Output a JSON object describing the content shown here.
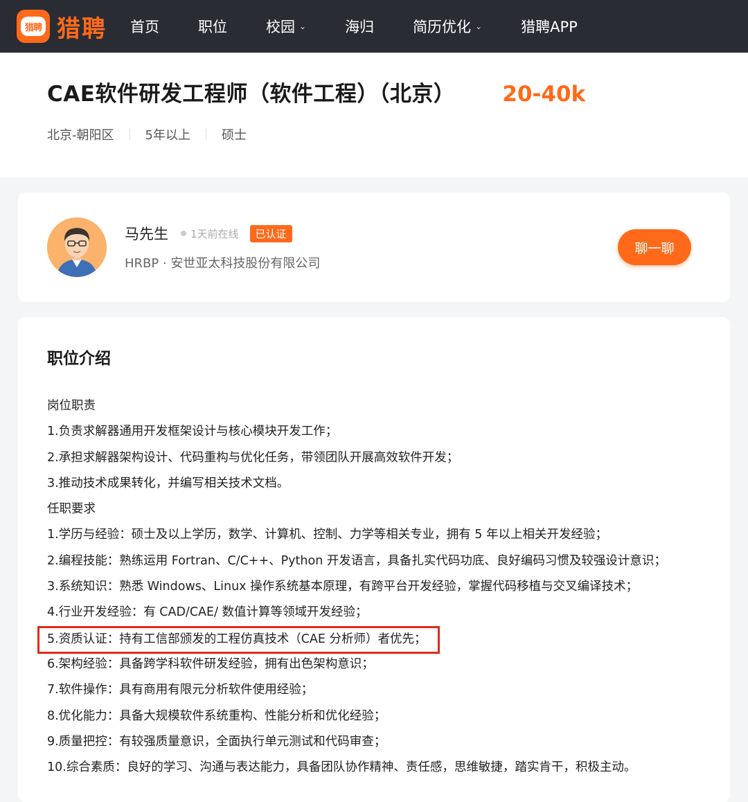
{
  "topbar": {
    "logo_badge": "猎聘",
    "logo_text": "猎聘",
    "nav": [
      {
        "label": "首页",
        "has_dropdown": false
      },
      {
        "label": "职位",
        "has_dropdown": false
      },
      {
        "label": "校园",
        "has_dropdown": true
      },
      {
        "label": "海归",
        "has_dropdown": false
      },
      {
        "label": "简历优化",
        "has_dropdown": true
      },
      {
        "label": "猎聘APP",
        "has_dropdown": false
      }
    ]
  },
  "job": {
    "title": "CAE软件研发工程师（软件工程）（北京）",
    "salary": "20-40k",
    "location": "北京-朝阳区",
    "experience": "5年以上",
    "education": "硕士"
  },
  "recruiter": {
    "name": "马先生",
    "online_status": "1天前在线",
    "verified_badge": "已认证",
    "subtitle": "HRBP · 安世亚太科技股份有限公司",
    "chat_button": "聊一聊"
  },
  "description": {
    "heading": "职位介绍",
    "lines": [
      "岗位职责",
      "1.负责求解器通用开发框架设计与核心模块开发工作；",
      "2.承担求解器架构设计、代码重构与优化任务，带领团队开展高效软件开发；",
      "3.推动技术成果转化，并编写相关技术文档。",
      "任职要求",
      "1.学历与经验：硕士及以上学历，数学、计算机、控制、力学等相关专业，拥有 5 年以上相关开发经验；",
      "2.编程技能：熟练运用 Fortran、C/C++、Python 开发语言，具备扎实代码功底、良好编码习惯及较强设计意识；",
      "3.系统知识：熟悉 Windows、Linux 操作系统基本原理，有跨平台开发经验，掌握代码移植与交叉编译技术；",
      "4.行业开发经验：有 CAD/CAE/ 数值计算等领域开发经验；",
      "5.资质认证：持有工信部颁发的工程仿真技术（CAE 分析师）者优先；",
      "6.架构经验：具备跨学科软件研发经验，拥有出色架构意识；",
      "7.软件操作：具有商用有限元分析软件使用经验；",
      "8.优化能力：具备大规模软件系统重构、性能分析和优化经验；",
      "9.质量把控：有较强质量意识，全面执行单元测试和代码审查；",
      "10.综合素质：良好的学习、沟通与表达能力，具备团队协作精神、责任感，思维敏捷，踏实肯干，积极主动。"
    ],
    "highlighted_line_index": 9
  },
  "colors": {
    "brand": "#ff6a1a",
    "topbar_bg": "#292c33",
    "highlight_border": "#e8271b"
  }
}
